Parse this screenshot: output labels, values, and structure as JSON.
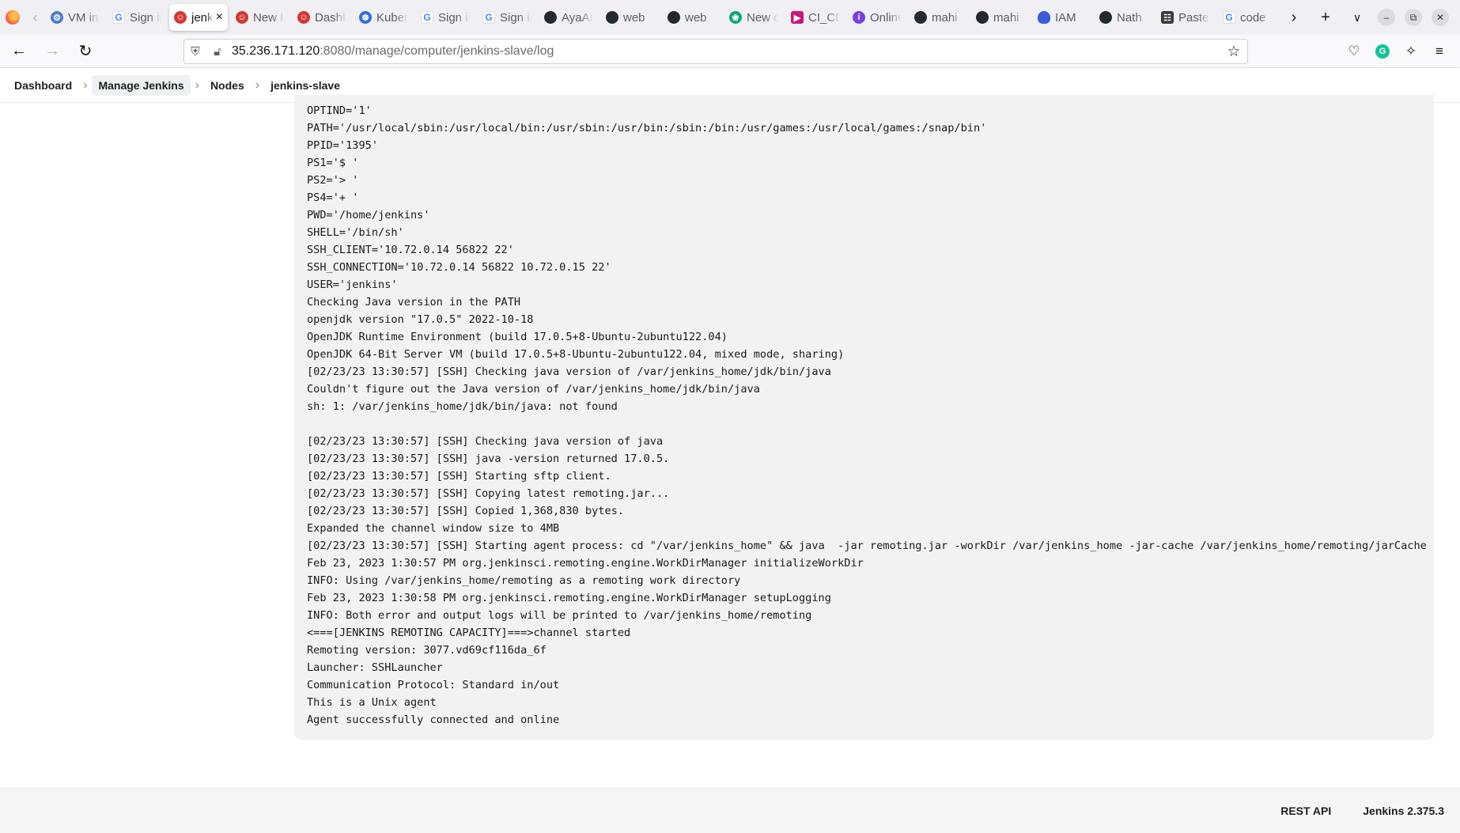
{
  "browser": {
    "tabs": [
      {
        "title": "VM instances",
        "favicon": "vm-icon",
        "active": false
      },
      {
        "title": "Sign in",
        "favicon": "google-icon",
        "active": false
      },
      {
        "title": "jenkins-slave log",
        "favicon": "jenkins-icon",
        "active": true
      },
      {
        "title": "New Item",
        "favicon": "jenkins-icon",
        "active": false
      },
      {
        "title": "Dashboard",
        "favicon": "jenkins-icon",
        "active": false
      },
      {
        "title": "Kubernetes",
        "favicon": "kubernetes-icon",
        "active": false
      },
      {
        "title": "Sign in",
        "favicon": "google-icon",
        "active": false
      },
      {
        "title": "Sign in",
        "favicon": "google-icon",
        "active": false
      },
      {
        "title": "AyaAI",
        "favicon": "github-icon",
        "active": false
      },
      {
        "title": "web",
        "favicon": "github-icon",
        "active": false
      },
      {
        "title": "web",
        "favicon": "github-icon",
        "active": false
      },
      {
        "title": "New chat",
        "favicon": "chatgpt-icon",
        "active": false
      },
      {
        "title": "CI_CD",
        "favicon": "ci-icon",
        "active": false
      },
      {
        "title": "Online",
        "favicon": "online-icon",
        "active": false
      },
      {
        "title": "mahi",
        "favicon": "github-icon",
        "active": false
      },
      {
        "title": "mahi",
        "favicon": "github-icon",
        "active": false
      },
      {
        "title": "IAM",
        "favicon": "iam-icon",
        "active": false
      },
      {
        "title": "Nath",
        "favicon": "github-icon",
        "active": false
      },
      {
        "title": "Paste",
        "favicon": "paste-icon",
        "active": false
      },
      {
        "title": "code",
        "favicon": "google-icon",
        "active": false
      }
    ],
    "url_host": "35.236.171.120",
    "url_rest": ":8080/manage/computer/jenkins-slave/log"
  },
  "breadcrumb": {
    "items": [
      "Dashboard",
      "Manage Jenkins",
      "Nodes",
      "jenkins-slave"
    ]
  },
  "log": {
    "lines": [
      "OPTIND='1'",
      "PATH='/usr/local/sbin:/usr/local/bin:/usr/sbin:/usr/bin:/sbin:/bin:/usr/games:/usr/local/games:/snap/bin'",
      "PPID='1395'",
      "PS1='$ '",
      "PS2='> '",
      "PS4='+ '",
      "PWD='/home/jenkins'",
      "SHELL='/bin/sh'",
      "SSH_CLIENT='10.72.0.14 56822 22'",
      "SSH_CONNECTION='10.72.0.14 56822 10.72.0.15 22'",
      "USER='jenkins'",
      "Checking Java version in the PATH",
      "openjdk version \"17.0.5\" 2022-10-18",
      "OpenJDK Runtime Environment (build 17.0.5+8-Ubuntu-2ubuntu122.04)",
      "OpenJDK 64-Bit Server VM (build 17.0.5+8-Ubuntu-2ubuntu122.04, mixed mode, sharing)",
      "[02/23/23 13:30:57] [SSH] Checking java version of /var/jenkins_home/jdk/bin/java",
      "Couldn't figure out the Java version of /var/jenkins_home/jdk/bin/java",
      "sh: 1: /var/jenkins_home/jdk/bin/java: not found",
      "",
      "[02/23/23 13:30:57] [SSH] Checking java version of java",
      "[02/23/23 13:30:57] [SSH] java -version returned 17.0.5.",
      "[02/23/23 13:30:57] [SSH] Starting sftp client.",
      "[02/23/23 13:30:57] [SSH] Copying latest remoting.jar...",
      "[02/23/23 13:30:57] [SSH] Copied 1,368,830 bytes.",
      "Expanded the channel window size to 4MB",
      "[02/23/23 13:30:57] [SSH] Starting agent process: cd \"/var/jenkins_home\" && java  -jar remoting.jar -workDir /var/jenkins_home -jar-cache /var/jenkins_home/remoting/jarCache",
      "Feb 23, 2023 1:30:57 PM org.jenkinsci.remoting.engine.WorkDirManager initializeWorkDir",
      "INFO: Using /var/jenkins_home/remoting as a remoting work directory",
      "Feb 23, 2023 1:30:58 PM org.jenkinsci.remoting.engine.WorkDirManager setupLogging",
      "INFO: Both error and output logs will be printed to /var/jenkins_home/remoting",
      "<===[JENKINS REMOTING CAPACITY]===>channel started",
      "Remoting version: 3077.vd69cf116da_6f",
      "Launcher: SSHLauncher",
      "Communication Protocol: Standard in/out",
      "This is a Unix agent",
      "Agent successfully connected and online"
    ]
  },
  "footer": {
    "rest_api": "REST API",
    "version": "Jenkins 2.375.3"
  }
}
